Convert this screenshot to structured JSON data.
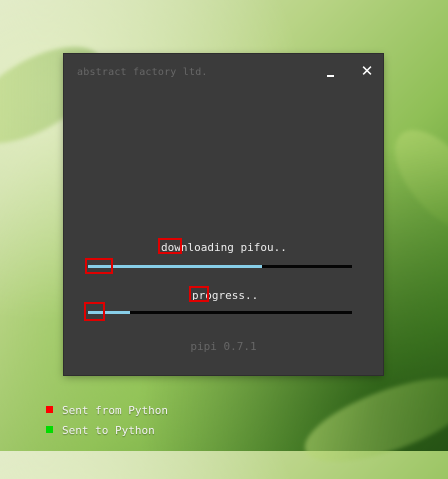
{
  "window": {
    "title": "abstract factory ltd.",
    "minimize_label": "_",
    "close_label": "✕",
    "version": "pipi 0.7.1"
  },
  "downloads": [
    {
      "label": "downloading pifou..",
      "progress": 0.66
    },
    {
      "label": "progress..",
      "progress": 0.16
    }
  ],
  "legend": {
    "sent_from": {
      "label": "Sent from Python",
      "color": "#ff0000"
    },
    "sent_to": {
      "label": "Sent to Python",
      "color": "#00dd00"
    }
  },
  "colors": {
    "window_bg": "#3b3b3b",
    "progress_fill": "#87cee8",
    "progress_track": "#050505",
    "marker": "#e00000"
  }
}
